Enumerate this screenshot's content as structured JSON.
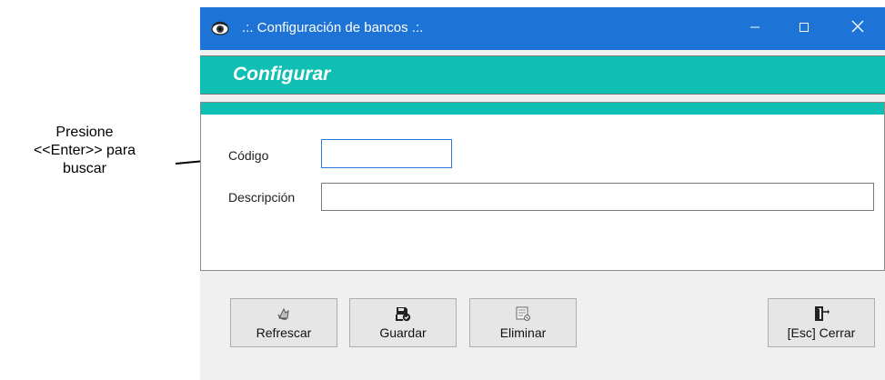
{
  "callout": {
    "lines": [
      "Presione",
      "<<Enter>> para",
      "buscar"
    ]
  },
  "window": {
    "title": ".:. Configuración de bancos .:.",
    "controls": {
      "minimize": "—",
      "maximize": "☐",
      "close": "✕"
    }
  },
  "header": {
    "title": "Configurar"
  },
  "form": {
    "codigo": {
      "label": "Código",
      "value": ""
    },
    "descripcion": {
      "label": "Descripción",
      "value": ""
    }
  },
  "buttons": {
    "refresh": "Refrescar",
    "save": "Guardar",
    "delete": "Eliminar",
    "close": "[Esc] Cerrar"
  },
  "colors": {
    "titlebar": "#1e73d6",
    "accent": "#0fbfb4",
    "focus": "#2b79d8"
  },
  "icons": [
    "eye-icon",
    "refresh-icon",
    "save-icon",
    "delete-icon",
    "exit-icon"
  ]
}
